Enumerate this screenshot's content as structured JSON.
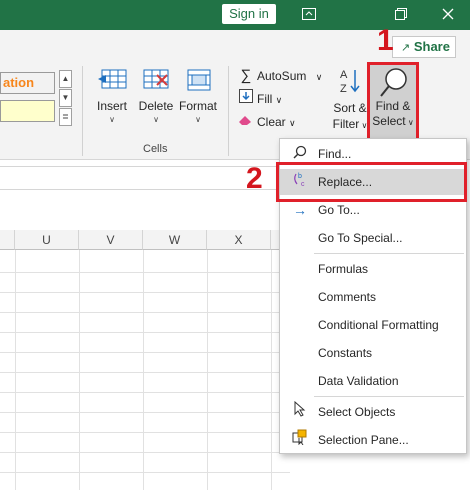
{
  "titlebar": {
    "signin_label": "Sign in",
    "icons": [
      "ribbon-display-icon",
      "restore-icon",
      "close-icon"
    ]
  },
  "ribbon": {
    "share_label": "Share",
    "style_cell": "ation",
    "cells": {
      "insert_label": "Insert",
      "delete_label": "Delete",
      "format_label": "Format",
      "group_label": "Cells"
    },
    "editing": {
      "autosum_label": "AutoSum",
      "fill_label": "Fill",
      "clear_label": "Clear",
      "sort_label_1": "Sort &",
      "sort_label_2": "Filter",
      "find_label_1": "Find &",
      "find_label_2": "Select"
    }
  },
  "annotations": {
    "step1": "1",
    "step2": "2"
  },
  "grid": {
    "columns": [
      "U",
      "V",
      "W",
      "X"
    ]
  },
  "menu": {
    "items": [
      {
        "label": "Find...",
        "icon": "magnifier-icon"
      },
      {
        "label": "Replace...",
        "icon": "replace-icon"
      },
      {
        "label": "Go To...",
        "icon": "arrow-right-icon"
      },
      {
        "label": "Go To Special...",
        "icon": ""
      },
      {
        "label": "Formulas",
        "icon": ""
      },
      {
        "label": "Comments",
        "icon": ""
      },
      {
        "label": "Conditional Formatting",
        "icon": ""
      },
      {
        "label": "Constants",
        "icon": ""
      },
      {
        "label": "Data Validation",
        "icon": ""
      },
      {
        "label": "Select Objects",
        "icon": "cursor-arrow-icon"
      },
      {
        "label": "Selection Pane...",
        "icon": "selection-pane-icon"
      }
    ]
  },
  "colors": {
    "title_green": "#217346",
    "highlight_red": "#e0202a",
    "style_orange": "#f7861c"
  }
}
